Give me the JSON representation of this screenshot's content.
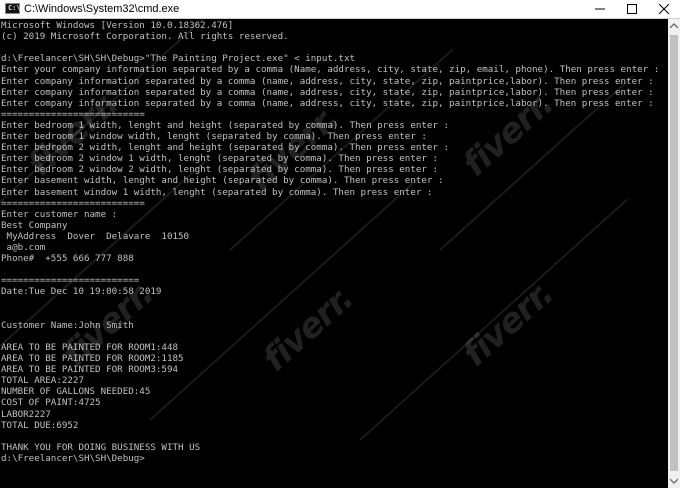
{
  "window": {
    "title": "C:\\Windows\\System32\\cmd.exe",
    "icon_label": "C:\\"
  },
  "console": {
    "lines": [
      "Microsoft Windows [Version 10.0.18362.476]",
      "(c) 2019 Microsoft Corporation. All rights reserved.",
      "",
      "d:\\Freelancer\\SH\\SH\\Debug>\"The Painting Project.exe\" < input.txt",
      "Enter your company information separated by a comma (Name, address, city, state, zip, email, phone). Then press enter :",
      "Enter company information separated by a comma (name, address, city, state, zip, paintprice,labor). Then press enter :",
      "Enter company information separated by a comma (name, address, city, state, zip, paintprice,labor). Then press enter :",
      "Enter company information separated by a comma (name, address, city, state, zip, paintprice,labor). Then press enter :",
      "==========================",
      "Enter bedroom 1 width, lenght and height (separated by comma). Then press enter :",
      "Enter bedroom 1 window width, lenght (separated by comma). Then press enter :",
      "Enter bedroom 2 width, lenght and height (separated by comma). Then press enter :",
      "Enter bedroom 2 window 1 width, lenght (separated by comma). Then press enter :",
      "Enter bedroom 2 window 2 width, lenght (separated by comma). Then press enter :",
      "Enter basement width, lenght and height (separated by comma). Then press enter :",
      "Enter basement window 1 width, lenght (separated by comma). Then press enter :",
      "==========================",
      "Enter customer name :",
      "Best Company",
      " MyAddress  Dover  Delavare  10150",
      " a@b.com",
      "Phone#  +555 666 777 888",
      "",
      "=========================",
      "Date:Tue Dec 10 19:00:58 2019",
      "",
      "",
      "Customer Name:John Smith",
      "",
      "AREA TO BE PAINTED FOR ROOM1:448",
      "AREA TO BE PAINTED FOR ROOM2:1185",
      "AREA TO BE PAINTED FOR ROOM3:594",
      "TOTAL AREA:2227",
      "NUMBER OF GALLONS NEEDED:45",
      "COST OF PAINT:4725",
      "LABOR2227",
      "TOTAL DUE:6952",
      "",
      "THANK YOU FOR DOING BUSINESS WITH US",
      "d:\\Freelancer\\SH\\SH\\Debug>"
    ]
  },
  "watermark": {
    "text": "fiverr."
  },
  "colors": {
    "console_bg": "#000000",
    "console_text": "#c0c0c0",
    "titlebar_bg": "#ffffff"
  },
  "icons": {
    "minimize": "minimize-icon",
    "maximize": "maximize-icon",
    "close": "close-icon",
    "app": "cmd-app-icon"
  }
}
